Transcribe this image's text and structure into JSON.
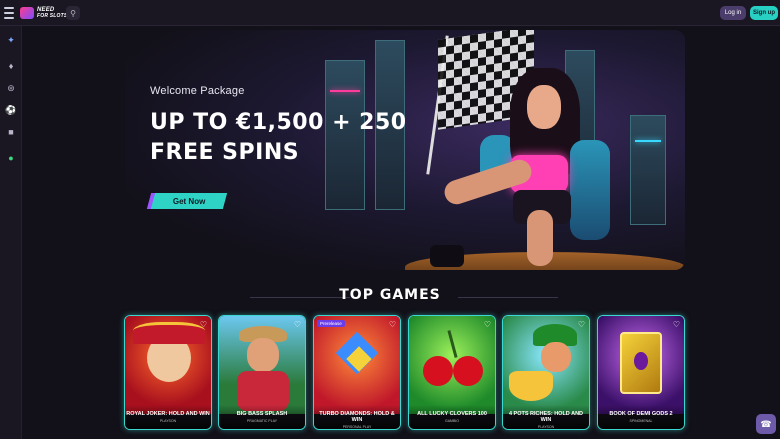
{
  "header": {
    "logo_line1": "NEED",
    "logo_line2": "FOR SLOTS",
    "login_label": "Log in",
    "signup_label": "Sign up"
  },
  "hero": {
    "subtitle": "Welcome Package",
    "title": "UP TO €1,500 + 250 FREE SPINS",
    "cta_label": "Get Now"
  },
  "top_games": {
    "title": "TOP GAMES",
    "games": [
      {
        "name": "ROYAL JOKER: HOLD AND WIN",
        "provider": "PLAYSON",
        "badge": ""
      },
      {
        "name": "BIG BASS SPLASH",
        "provider": "PRAGMATIC PLAY",
        "badge": ""
      },
      {
        "name": "TURBO DIAMONDS: HOLD & WIN",
        "provider": "PERSONAL PLAY",
        "badge": "Prerelease"
      },
      {
        "name": "ALL LUCKY CLOVERS 100",
        "provider": "GAMBIO",
        "badge": ""
      },
      {
        "name": "4 POTS RICHES: HOLD AND WIN",
        "provider": "PLAYSON",
        "badge": ""
      },
      {
        "name": "BOOK OF DEMI GODS 2",
        "provider": "SPINOMENAL",
        "badge": ""
      }
    ]
  },
  "colors": {
    "accent": "#2ed3c6",
    "brand": "#9b57ff",
    "background": "#121018"
  },
  "icons": {
    "menu": "hamburger-icon",
    "search": "search-icon",
    "favorite": "heart-icon",
    "chat": "headset-icon"
  }
}
